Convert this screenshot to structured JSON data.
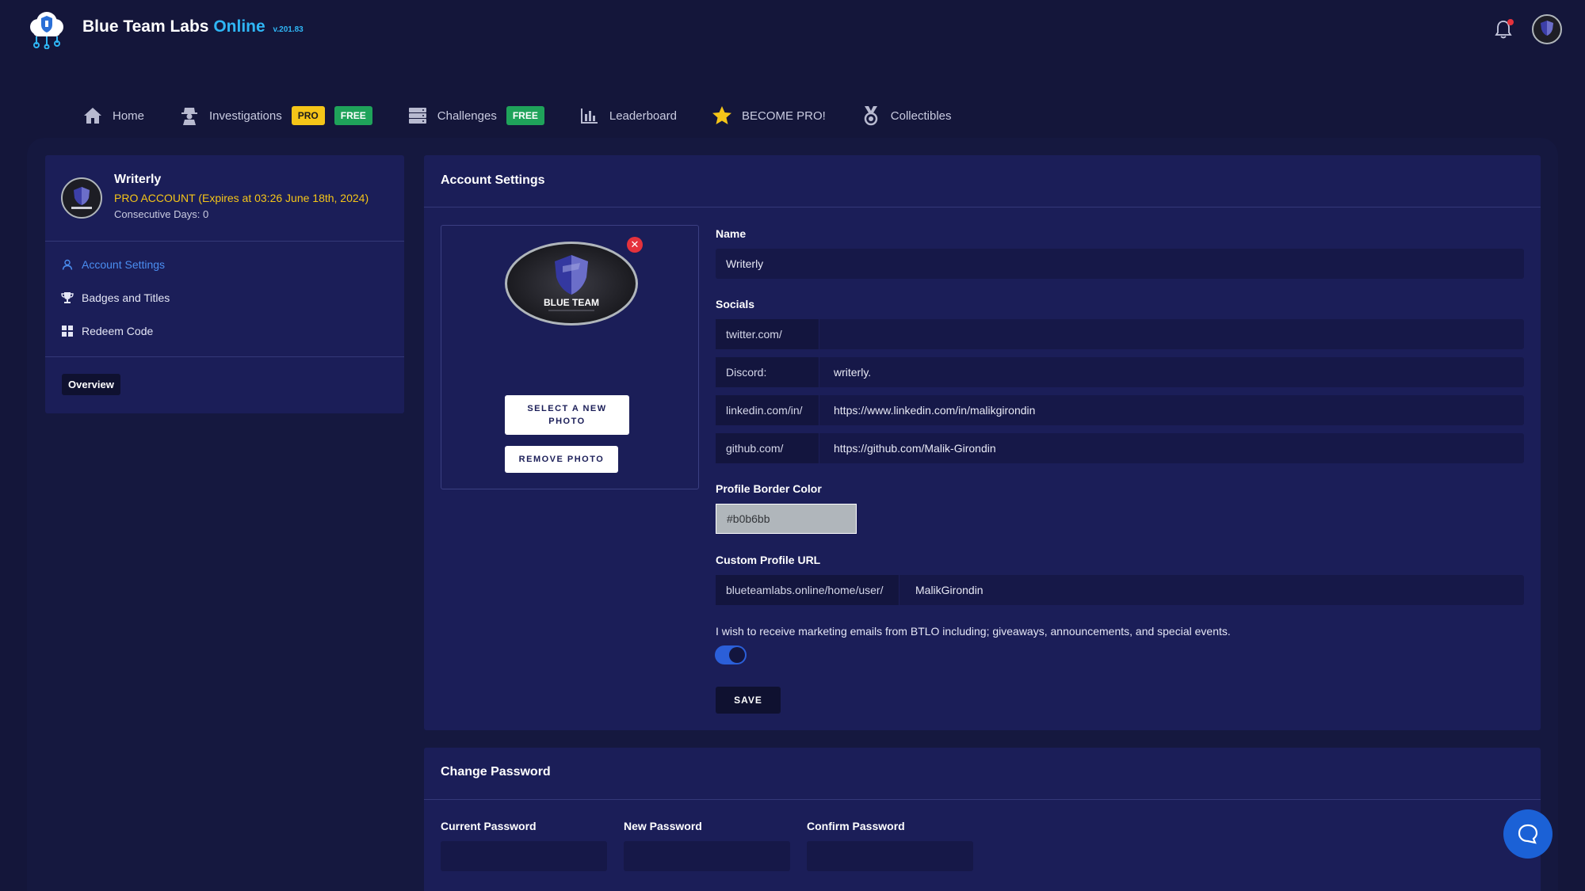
{
  "header": {
    "brand_main": "Blue Team Labs",
    "brand_accent": "Online",
    "version": "v.201.83",
    "logo_icon": "cloud-shield-icon",
    "notification_icon": "bell-icon"
  },
  "nav": {
    "home": "Home",
    "investigations": "Investigations",
    "investigations_badge_pro": "PRO",
    "investigations_badge_free": "FREE",
    "challenges": "Challenges",
    "challenges_badge_free": "FREE",
    "leaderboard": "Leaderboard",
    "become_pro": "BECOME PRO!",
    "collectibles": "Collectibles"
  },
  "profile": {
    "name": "Writerly",
    "pro_status": "PRO ACCOUNT (Expires at 03:26 June 18th, 2024)",
    "consecutive_days": "Consecutive Days: 0"
  },
  "sidebar": {
    "items": [
      {
        "label": "Account Settings",
        "icon": "user-icon"
      },
      {
        "label": "Badges and Titles",
        "icon": "trophy-icon"
      },
      {
        "label": "Redeem Code",
        "icon": "grid-icon"
      }
    ],
    "overview_label": "Overview"
  },
  "account_settings": {
    "title": "Account Settings",
    "photo_text": "BLUE TEAM",
    "select_photo_label": "SELECT A NEW PHOTO",
    "remove_photo_label": "REMOVE PHOTO",
    "name_label": "Name",
    "name_value": "Writerly",
    "socials_label": "Socials",
    "socials": [
      {
        "prefix": "twitter.com/",
        "value": ""
      },
      {
        "prefix": "Discord:",
        "value": "writerly."
      },
      {
        "prefix": "linkedin.com/in/",
        "value": "https://www.linkedin.com/in/malikgirondin"
      },
      {
        "prefix": "github.com/",
        "value": "https://github.com/Malik-Girondin"
      }
    ],
    "border_color_label": "Profile Border Color",
    "border_color_value": "#b0b6bb",
    "custom_url_label": "Custom Profile URL",
    "custom_url_prefix": "blueteamlabs.online/home/user/",
    "custom_url_value": "MalikGirondin",
    "marketing_text": "I wish to receive marketing emails from BTLO including; giveaways, announcements, and special events.",
    "marketing_opt_in": true,
    "save_label": "SAVE"
  },
  "change_password": {
    "title": "Change Password",
    "current_label": "Current Password",
    "new_label": "New Password",
    "confirm_label": "Confirm Password"
  },
  "colors": {
    "page_bg": "#14163a",
    "card_bg": "#1b1e58",
    "accent_blue": "#2fb6f5",
    "link_blue": "#4b8ef1",
    "pro_yellow": "#f5c518",
    "free_green": "#1fa35a",
    "alert_red": "#e5323c"
  }
}
